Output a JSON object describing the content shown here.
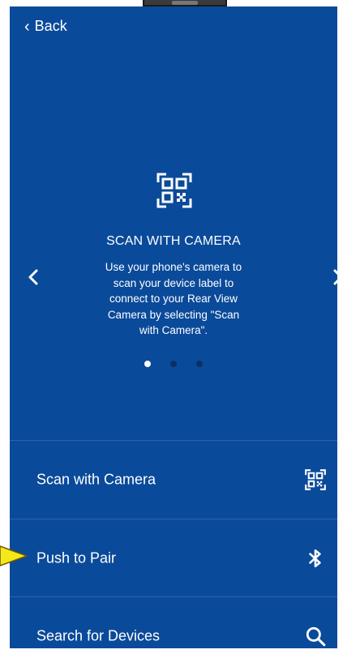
{
  "header": {
    "back_label": "Back"
  },
  "carousel": {
    "title": "SCAN WITH CAMERA",
    "description": "Use your phone's camera to scan your device label to connect to your Rear View Camera by selecting \"Scan with Camera\".",
    "page_count": 3,
    "active_index": 0,
    "icon": "qr-code-icon"
  },
  "options": [
    {
      "label": "Scan with Camera",
      "icon": "qr-code-icon"
    },
    {
      "label": "Push to Pair",
      "icon": "bluetooth-icon"
    },
    {
      "label": "Search for Devices",
      "icon": "search-icon"
    }
  ],
  "colors": {
    "background": "#0a4a9a",
    "divider": "#2d63ad",
    "pointer": "#f4e81a"
  }
}
